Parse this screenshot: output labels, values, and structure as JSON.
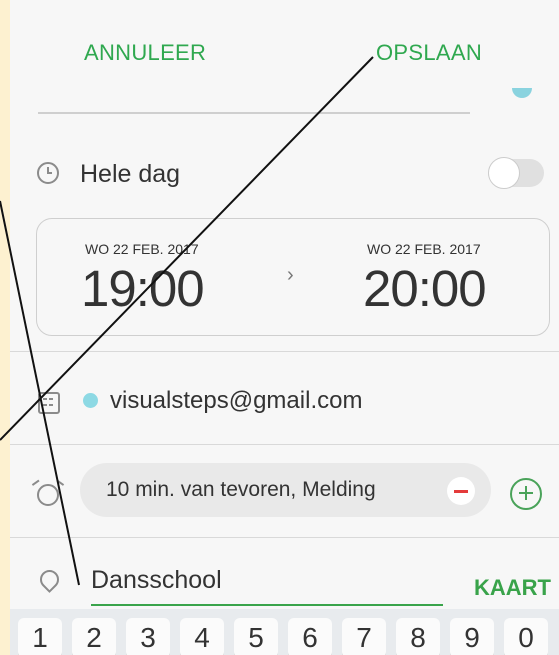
{
  "header": {
    "cancel_label": "ANNULEER",
    "save_label": "OPSLAAN"
  },
  "event": {
    "all_day_label": "Hele dag",
    "start_date": "WO 22 FEB. 2017",
    "end_date": "WO 22 FEB. 2017",
    "start_time": "19:00",
    "end_time": "20:00",
    "account": "visualsteps@gmail.com",
    "reminder": "10 min. van tevoren, Melding",
    "location": "Dansschool",
    "map_label": "KAART"
  },
  "keyboard": {
    "keys": [
      "1",
      "2",
      "3",
      "4",
      "5",
      "6",
      "7",
      "8",
      "9",
      "0"
    ]
  },
  "colors": {
    "accent": "#2fa84f",
    "cyan_dot": "#8dd9e4",
    "remove_red": "#e43b3b",
    "background": "#fdf1d0"
  }
}
